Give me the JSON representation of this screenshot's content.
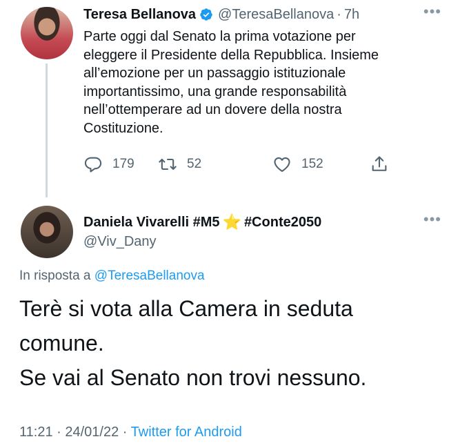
{
  "tweet_parent": {
    "author_name": "Teresa Bellanova",
    "handle": "@TeresaBellanova",
    "separator": "·",
    "time": "7h",
    "more": "•••",
    "text_lines": [
      "Parte oggi dal Senato la prima votazione per",
      "eleggere il Presidente della Repubblica. Insieme",
      "all’emozione per un passaggio istituzionale",
      "importantissimo, una grande responsabilità",
      "nell’ottemperare ad un dovere della nostra",
      "Costituzione."
    ],
    "replies": "179",
    "retweets": "52",
    "likes": "152"
  },
  "tweet_reply": {
    "author_name_part1": "Daniela Vivarelli #M5",
    "star": "⭐",
    "author_name_part2": "#Conte2050",
    "handle": "@Viv_Dany",
    "more": "•••",
    "reply_to_prefix": "In risposta a",
    "reply_to_mention": "@TeresaBellanova",
    "text_lines": [
      "Terè si vota alla Camera in seduta",
      "comune.",
      "Se vai al Senato non trovi nessuno."
    ],
    "time": "11:21",
    "date": "24/01/22",
    "separator": "·",
    "source": "Twitter for Android"
  },
  "colors": {
    "text": "#0f1419",
    "secondary": "#536471",
    "link": "#1d9bf0",
    "verified": "#1d9bf0"
  }
}
